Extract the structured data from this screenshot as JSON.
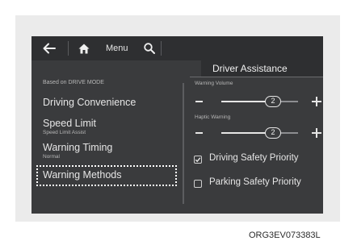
{
  "topbar": {
    "back_icon": "back-arrow-icon",
    "home_icon": "home-icon",
    "menu_label": "Menu",
    "search_icon": "search-icon"
  },
  "title": "Driver Assistance",
  "left_menu": {
    "header": "Based on DRIVE MODE",
    "items": [
      {
        "label": "Driving Convenience"
      },
      {
        "label": "Speed Limit",
        "sub": "Speed Limit Assist"
      },
      {
        "label": "Warning Timing",
        "sub": "Normal"
      },
      {
        "label": "Warning Methods",
        "focused": true
      }
    ]
  },
  "settings": {
    "warning_volume": {
      "label": "Warning Volume",
      "value": "2"
    },
    "haptic_warning": {
      "label": "Haptic Warning",
      "value": "2"
    },
    "checkboxes": [
      {
        "label": "Driving Safety Priority",
        "checked": true
      },
      {
        "label": "Parking Safety Priority",
        "checked": false
      }
    ]
  },
  "caption": "ORG3EV073383L",
  "colors": {
    "screen_bg": "#3a3b3d",
    "bar_bg": "#2e2f31",
    "text": "#e6e6e6",
    "muted_text": "#b7b7b7",
    "frame_bg": "#ebebeb"
  }
}
